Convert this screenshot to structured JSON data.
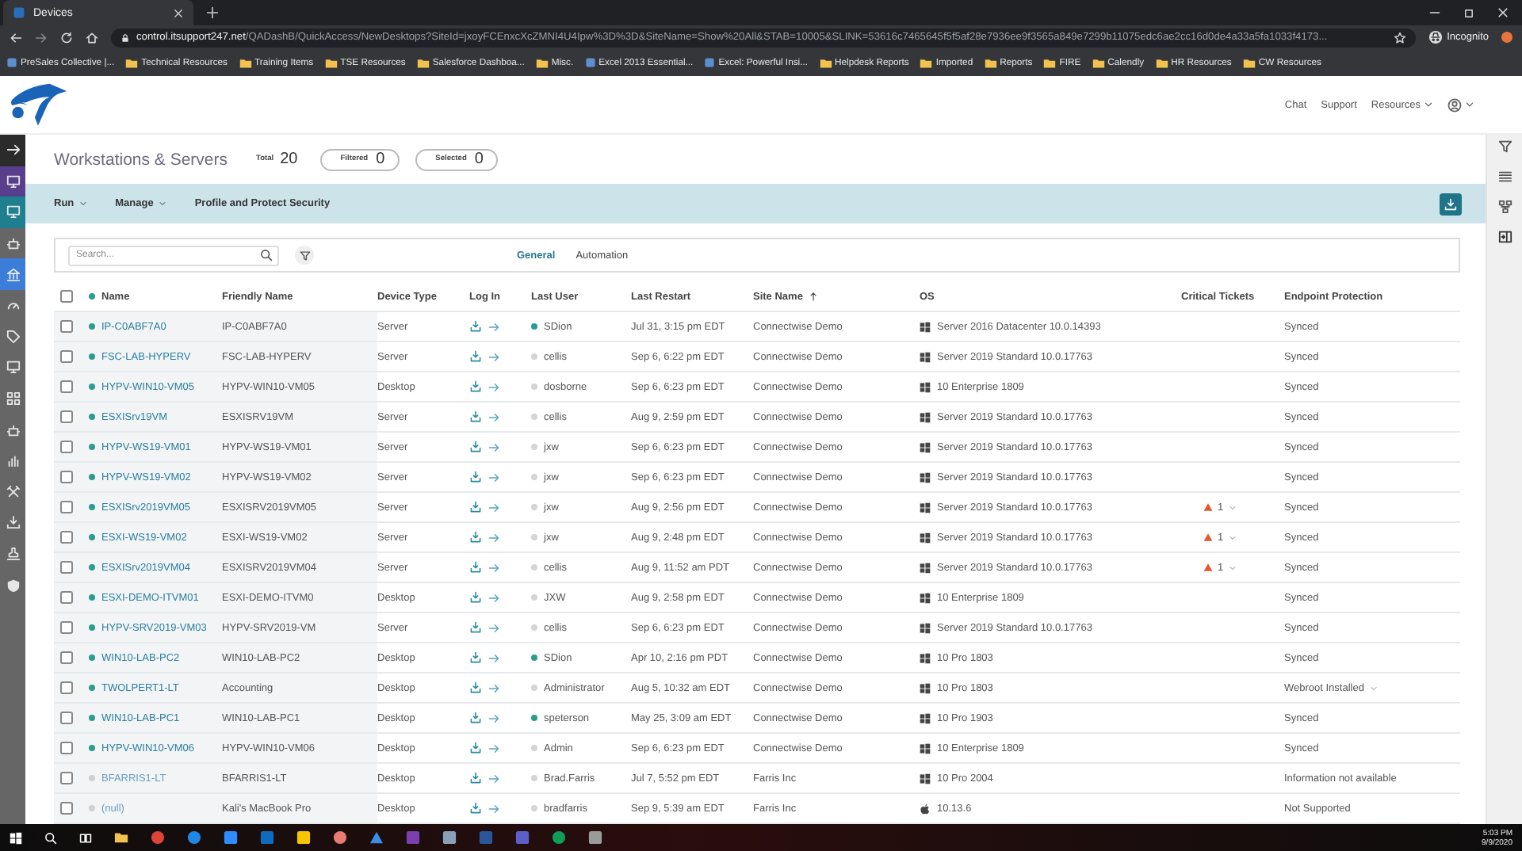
{
  "browser": {
    "tab": {
      "title": "Devices"
    },
    "url": {
      "host": "control.itsupport247.net",
      "path": "/QADashB/QuickAccess/NewDesktops?SiteId=jxoyFCEnxcXcZMNI4U4Ipw%3D%3D&SiteName=Show%20All&STAB=10005&SLINK=53616c7465645f5f5af28e7936ee9f3565a849e7299b11075edc6ae2cc16d0de4a33a5fa1033f4173..."
    },
    "profile": "Incognito",
    "bookmarks": [
      {
        "label": "PreSales Collective |...",
        "kind": "site"
      },
      {
        "label": "Technical Resources",
        "kind": "folder"
      },
      {
        "label": "Training Items",
        "kind": "folder"
      },
      {
        "label": "TSE Resources",
        "kind": "folder"
      },
      {
        "label": "Salesforce Dashboa...",
        "kind": "folder"
      },
      {
        "label": "Misc.",
        "kind": "folder"
      },
      {
        "label": "Excel 2013 Essential...",
        "kind": "site"
      },
      {
        "label": "Excel: Powerful Insi...",
        "kind": "site"
      },
      {
        "label": "Helpdesk Reports",
        "kind": "folder"
      },
      {
        "label": "Imported",
        "kind": "folder"
      },
      {
        "label": "Reports",
        "kind": "folder"
      },
      {
        "label": "FIRE",
        "kind": "folder"
      },
      {
        "label": "Calendly",
        "kind": "folder"
      },
      {
        "label": "HR Resources",
        "kind": "folder"
      },
      {
        "label": "CW Resources",
        "kind": "folder"
      }
    ]
  },
  "header": {
    "links": [
      "Chat",
      "Support",
      "Resources"
    ]
  },
  "nav_items": [
    {
      "color": "#2b2b2b"
    },
    {
      "color": "#5a3e8e"
    },
    {
      "color": "#1e7f8f"
    },
    {
      "color": "#666666"
    },
    {
      "color": "#3b7dd8"
    },
    {
      "color": "#666666"
    },
    {
      "color": "#666666"
    },
    {
      "color": "#666666"
    },
    {
      "color": "#666666"
    },
    {
      "color": "#666666"
    },
    {
      "color": "#666666"
    },
    {
      "color": "#666666"
    },
    {
      "color": "#666666"
    },
    {
      "color": "#666666"
    },
    {
      "color": "#666666"
    }
  ],
  "page": {
    "title": "Workstations & Servers",
    "total_label": "Total",
    "total": "20",
    "filtered_label": "Filtered",
    "filtered": "0",
    "selected_label": "Selected",
    "selected": "0"
  },
  "toolbar": {
    "menus": [
      {
        "label": "Run",
        "dropdown": true
      },
      {
        "label": "Manage",
        "dropdown": true
      },
      {
        "label": "Profile and Protect Security",
        "dropdown": false
      }
    ]
  },
  "search": {
    "placeholder": "Search..."
  },
  "tabs": [
    {
      "label": "General",
      "selected": true
    },
    {
      "label": "Automation",
      "selected": false
    }
  ],
  "table": {
    "all_checked": false,
    "columns": [
      {
        "label": "Name",
        "sorted": false
      },
      {
        "label": "Friendly Name",
        "sorted": false
      },
      {
        "label": "Device Type",
        "sorted": false
      },
      {
        "label": "Log In",
        "sorted": false
      },
      {
        "label": "Last User",
        "sorted": false
      },
      {
        "label": "Last Restart",
        "sorted": false
      },
      {
        "label": "Site Name",
        "sorted": true
      },
      {
        "label": "OS",
        "sorted": false
      },
      {
        "label": "Critical Tickets",
        "sorted": false
      },
      {
        "label": "Endpoint Protection",
        "sorted": false
      }
    ],
    "rows": [
      {
        "checked": false,
        "online": true,
        "name": "IP-C0ABF7A0",
        "friendly_name": "IP-C0ABF7A0",
        "device_type": "Server",
        "user_active": true,
        "last_user": "SDion",
        "last_restart": "Jul 31, 3:15 pm EDT",
        "site": "Connectwise Demo",
        "os": {
          "kind": "windows",
          "name": "Server 2016 Datacenter 10.0.14393"
        },
        "endpoint": "Synced",
        "endpoint_menu": false
      },
      {
        "checked": false,
        "online": true,
        "name": "FSC-LAB-HYPERV",
        "friendly_name": "FSC-LAB-HYPERV",
        "device_type": "Server",
        "user_active": false,
        "last_user": "cellis",
        "last_restart": "Sep 6, 6:22 pm EDT",
        "site": "Connectwise Demo",
        "os": {
          "kind": "windows",
          "name": "Server 2019 Standard 10.0.17763"
        },
        "endpoint": "Synced",
        "endpoint_menu": false
      },
      {
        "checked": false,
        "online": true,
        "name": "HYPV-WIN10-VM05",
        "friendly_name": "HYPV-WIN10-VM05",
        "device_type": "Desktop",
        "user_active": false,
        "last_user": "dosborne",
        "last_restart": "Sep 6, 6:23 pm EDT",
        "site": "Connectwise Demo",
        "os": {
          "kind": "windows",
          "name": "10 Enterprise 1809"
        },
        "endpoint": "Synced",
        "endpoint_menu": false
      },
      {
        "checked": false,
        "online": true,
        "name": "ESXISrv19VM",
        "friendly_name": "ESXISRV19VM",
        "device_type": "Server",
        "user_active": false,
        "last_user": "cellis",
        "last_restart": "Aug 9, 2:59 pm EDT",
        "site": "Connectwise Demo",
        "os": {
          "kind": "windows",
          "name": "Server 2019 Standard 10.0.17763"
        },
        "endpoint": "Synced",
        "endpoint_menu": false
      },
      {
        "checked": false,
        "online": true,
        "name": "HYPV-WS19-VM01",
        "friendly_name": "HYPV-WS19-VM01",
        "device_type": "Server",
        "user_active": false,
        "last_user": "jxw",
        "last_restart": "Sep 6, 6:23 pm EDT",
        "site": "Connectwise Demo",
        "os": {
          "kind": "windows",
          "name": "Server 2019 Standard 10.0.17763"
        },
        "endpoint": "Synced",
        "endpoint_menu": false
      },
      {
        "checked": false,
        "online": true,
        "name": "HYPV-WS19-VM02",
        "friendly_name": "HYPV-WS19-VM02",
        "device_type": "Server",
        "user_active": false,
        "last_user": "jxw",
        "last_restart": "Sep 6, 6:23 pm EDT",
        "site": "Connectwise Demo",
        "os": {
          "kind": "windows",
          "name": "Server 2019 Standard 10.0.17763"
        },
        "endpoint": "Synced",
        "endpoint_menu": false
      },
      {
        "checked": false,
        "online": true,
        "name": "ESXISrv2019VM05",
        "friendly_name": "ESXISRV2019VM05",
        "device_type": "Server",
        "user_active": false,
        "last_user": "jxw",
        "last_restart": "Aug 9, 2:56 pm EDT",
        "site": "Connectwise Demo",
        "os": {
          "kind": "windows",
          "name": "Server 2019 Standard 10.0.17763"
        },
        "critical_tickets": "1",
        "endpoint": "Synced",
        "endpoint_menu": false
      },
      {
        "checked": false,
        "online": true,
        "name": "ESXI-WS19-VM02",
        "friendly_name": "ESXI-WS19-VM02",
        "device_type": "Server",
        "user_active": false,
        "last_user": "jxw",
        "last_restart": "Aug 9, 2:48 pm EDT",
        "site": "Connectwise Demo",
        "os": {
          "kind": "windows",
          "name": "Server 2019 Standard 10.0.17763"
        },
        "critical_tickets": "1",
        "endpoint": "Synced",
        "endpoint_menu": false
      },
      {
        "checked": false,
        "online": true,
        "name": "ESXISrv2019VM04",
        "friendly_name": "ESXISRV2019VM04",
        "device_type": "Server",
        "user_active": false,
        "last_user": "cellis",
        "last_restart": "Aug 9, 11:52 am PDT",
        "site": "Connectwise Demo",
        "os": {
          "kind": "windows",
          "name": "Server 2019 Standard 10.0.17763"
        },
        "critical_tickets": "1",
        "endpoint": "Synced",
        "endpoint_menu": false
      },
      {
        "checked": false,
        "online": true,
        "name": "ESXI-DEMO-ITVM01",
        "friendly_name": "ESXI-DEMO-ITVM0",
        "device_type": "Desktop",
        "user_active": false,
        "last_user": "JXW",
        "last_restart": "Aug 9, 2:58 pm EDT",
        "site": "Connectwise Demo",
        "os": {
          "kind": "windows",
          "name": "10 Enterprise 1809"
        },
        "endpoint": "Synced",
        "endpoint_menu": false
      },
      {
        "checked": false,
        "online": true,
        "name": "HYPV-SRV2019-VM03",
        "friendly_name": "HYPV-SRV2019-VM",
        "device_type": "Server",
        "user_active": false,
        "last_user": "cellis",
        "last_restart": "Sep 6, 6:23 pm EDT",
        "site": "Connectwise Demo",
        "os": {
          "kind": "windows",
          "name": "Server 2019 Standard 10.0.17763"
        },
        "endpoint": "Synced",
        "endpoint_menu": false
      },
      {
        "checked": false,
        "online": true,
        "name": "WIN10-LAB-PC2",
        "friendly_name": "WIN10-LAB-PC2",
        "device_type": "Desktop",
        "user_active": true,
        "last_user": "SDion",
        "last_restart": "Apr 10, 2:16 pm PDT",
        "site": "Connectwise Demo",
        "os": {
          "kind": "windows",
          "name": "10 Pro 1803"
        },
        "endpoint": "Synced",
        "endpoint_menu": false
      },
      {
        "checked": false,
        "online": true,
        "name": "TWOLPERT1-LT",
        "friendly_name": "Accounting",
        "device_type": "Desktop",
        "user_active": false,
        "last_user": "Administrator",
        "last_restart": "Aug 5, 10:32 am EDT",
        "site": "Connectwise Demo",
        "os": {
          "kind": "windows",
          "name": "10 Pro 1803"
        },
        "endpoint": "Webroot Installed",
        "endpoint_menu": true
      },
      {
        "checked": false,
        "online": true,
        "name": "WIN10-LAB-PC1",
        "friendly_name": "WIN10-LAB-PC1",
        "device_type": "Desktop",
        "user_active": true,
        "last_user": "speterson",
        "last_restart": "May 25, 3:09 am EDT",
        "site": "Connectwise Demo",
        "os": {
          "kind": "windows",
          "name": "10 Pro 1903"
        },
        "endpoint": "Synced",
        "endpoint_menu": false
      },
      {
        "checked": false,
        "online": true,
        "name": "HYPV-WIN10-VM06",
        "friendly_name": "HYPV-WIN10-VM06",
        "device_type": "Desktop",
        "user_active": false,
        "last_user": "Admin",
        "last_restart": "Sep 6, 6:23 pm EDT",
        "site": "Connectwise Demo",
        "os": {
          "kind": "windows",
          "name": "10 Enterprise 1809"
        },
        "endpoint": "Synced",
        "endpoint_menu": false
      },
      {
        "checked": false,
        "online": false,
        "name": "BFARRIS1-LT",
        "friendly_name": "BFARRIS1-LT",
        "device_type": "Desktop",
        "user_active": false,
        "last_user": "Brad.Farris",
        "last_restart": "Jul 7, 5:52 pm EDT",
        "site": "Farris Inc",
        "os": {
          "kind": "windows",
          "name": "10 Pro 2004"
        },
        "endpoint": "Information not available",
        "endpoint_menu": false
      },
      {
        "checked": false,
        "online": false,
        "name": "(null)",
        "friendly_name": "Kali's MacBook Pro",
        "device_type": "Desktop",
        "user_active": false,
        "last_user": "bradfarris",
        "last_restart": "Sep 9, 5:39 am EDT",
        "site": "Farris Inc",
        "os": {
          "kind": "apple",
          "name": "10.13.6"
        },
        "endpoint": "Not Supported",
        "endpoint_menu": false
      }
    ]
  },
  "taskbar": {
    "time": "5:03 PM",
    "date": "9/9/2020"
  }
}
